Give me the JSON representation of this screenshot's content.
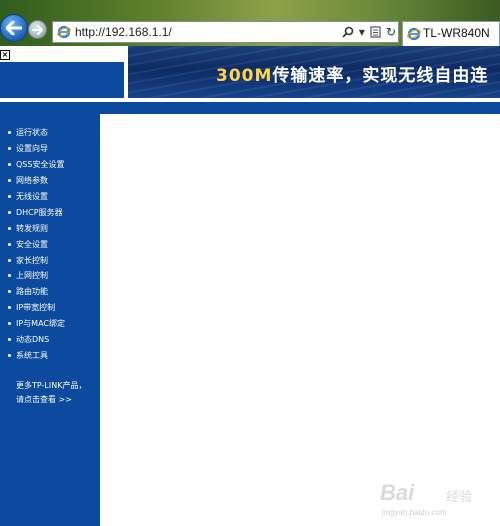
{
  "browser": {
    "url": "http://192.168.1.1/",
    "tab_title": "TL-WR840N",
    "icons": [
      "back-arrow-icon",
      "forward-arrow-icon",
      "ie-icon",
      "search-icon",
      "dropdown-icon",
      "compat-icon",
      "refresh-icon"
    ]
  },
  "header": {
    "banner_highlight": "300M",
    "banner_text": "传输速率，实现无线自由连"
  },
  "sidebar": {
    "items": [
      {
        "label": "运行状态"
      },
      {
        "label": "设置向导"
      },
      {
        "label": "QSS安全设置"
      },
      {
        "label": "网络参数"
      },
      {
        "label": "无线设置"
      },
      {
        "label": "DHCP服务器"
      },
      {
        "label": "转发规则"
      },
      {
        "label": "安全设置"
      },
      {
        "label": "家长控制"
      },
      {
        "label": "上网控制"
      },
      {
        "label": "路由功能"
      },
      {
        "label": "IP带宽控制"
      },
      {
        "label": "IP与MAC绑定"
      },
      {
        "label": "动态DNS"
      },
      {
        "label": "系统工具"
      }
    ],
    "more_line1": "更多TP-LINK产品，",
    "more_line2": "请点击查看 >>"
  },
  "watermark": {
    "brand": "Bai",
    "sub": "经验",
    "url": "jingyan.baidu.com"
  },
  "colors": {
    "frame_blue": "#0b4a9e",
    "banner_highlight": "#ffd54a"
  }
}
